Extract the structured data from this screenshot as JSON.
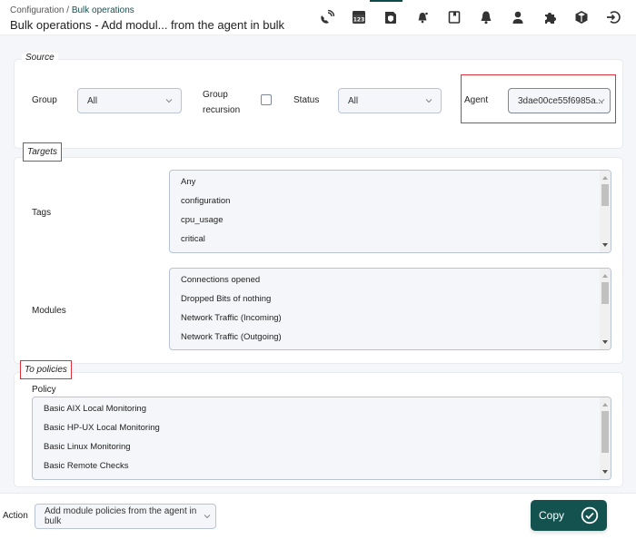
{
  "header": {
    "breadcrumb": {
      "parent": "Configuration",
      "separator": " / ",
      "current": "Bulk operations"
    },
    "title": "Bulk operations - Add modul... from the agent in bulk",
    "icons": [
      "satellite-icon",
      "calendar-123-icon",
      "shield-document-icon",
      "bell-alert-icon",
      "bookmark-icon",
      "bell-icon",
      "user-icon",
      "puzzle-icon",
      "cube-icon",
      "logout-icon"
    ]
  },
  "source": {
    "legend": "Source",
    "group_label": "Group",
    "group_value": "All",
    "recursion_label": "Group recursion",
    "recursion_checked": false,
    "status_label": "Status",
    "status_value": "All",
    "agent_label": "Agent",
    "agent_value": "3dae00ce55f6985a..."
  },
  "targets": {
    "legend": "Targets",
    "tags_label": "Tags",
    "tags": [
      "Any",
      "configuration",
      "cpu_usage",
      "critical"
    ],
    "modules_label": "Modules",
    "modules": [
      "Connections opened",
      "Dropped Bits of nothing",
      "Network Traffic (Incoming)",
      "Network Traffic (Outgoing)"
    ]
  },
  "policies": {
    "legend": "To policies",
    "policy_label": "Policy",
    "items": [
      "Basic AIX Local Monitoring",
      "Basic HP-UX Local Monitoring",
      "Basic Linux Monitoring",
      "Basic Remote Checks"
    ]
  },
  "footer": {
    "action_label": "Action",
    "action_value": "Add module policies from the agent in bulk",
    "copy_label": "Copy"
  },
  "colors": {
    "accent": "#13524e",
    "highlight_border": "#e0303a"
  }
}
